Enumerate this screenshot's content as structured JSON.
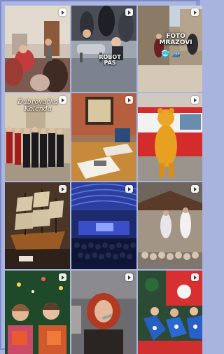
{
  "tiles": [
    {
      "id": "tile-1",
      "name": "tile-family-room",
      "reel": true
    },
    {
      "id": "tile-2",
      "name": "tile-robot-pas",
      "reel": true,
      "caption": "ROBOT PAS"
    },
    {
      "id": "tile-3",
      "name": "tile-foto-mrazovi",
      "reel": true,
      "caption": "FOTO MRAZOVI",
      "emoji": "🥶 🚙"
    },
    {
      "id": "tile-4",
      "name": "tile-dubrovacka-kolenda",
      "reel": true,
      "caption": "Dubrovačka Kolenda"
    },
    {
      "id": "tile-5",
      "name": "tile-office-desk",
      "reel": true
    },
    {
      "id": "tile-6",
      "name": "tile-mascot-bus",
      "reel": true
    },
    {
      "id": "tile-7",
      "name": "tile-ship-model",
      "reel": true
    },
    {
      "id": "tile-8",
      "name": "tile-concert-hall",
      "reel": true
    },
    {
      "id": "tile-9",
      "name": "tile-nativity-scene",
      "reel": true
    },
    {
      "id": "tile-10",
      "name": "tile-children-christmas",
      "reel": true
    },
    {
      "id": "tile-11",
      "name": "tile-singer-microphone",
      "reel": true
    },
    {
      "id": "tile-12",
      "name": "tile-kids-drawings",
      "reel": true
    }
  ],
  "colors": {
    "background": "#aab6e0",
    "reel_icon": "#ffffff"
  },
  "icons": {
    "reel": "reel-icon"
  }
}
